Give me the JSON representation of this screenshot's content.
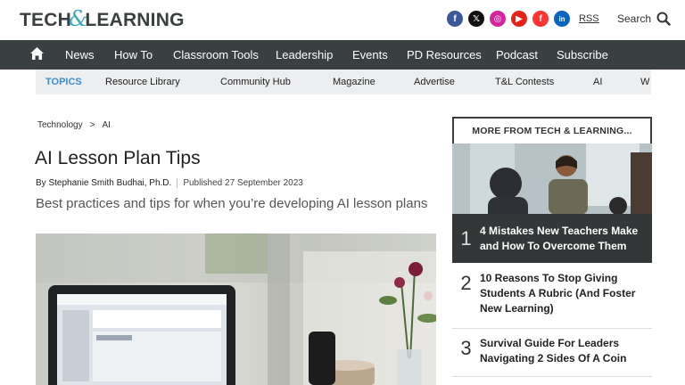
{
  "header": {
    "logo": {
      "part1": "TECH",
      "amp": "&",
      "part2": "LEARNING"
    },
    "social": [
      {
        "name": "facebook",
        "glyph": "f"
      },
      {
        "name": "x",
        "glyph": "𝕏"
      },
      {
        "name": "instagram",
        "glyph": "◎"
      },
      {
        "name": "youtube",
        "glyph": "▶"
      },
      {
        "name": "flipboard",
        "glyph": "f"
      },
      {
        "name": "linkedin",
        "glyph": "in"
      }
    ],
    "rss": "RSS",
    "search_label": "Search"
  },
  "mainnav": {
    "items": [
      "News",
      "How To",
      "Classroom Tools",
      "Leadership",
      "Events",
      "PD Resources",
      "Podcast",
      "Subscribe"
    ]
  },
  "topics": {
    "label": "TOPICS",
    "items": [
      "Resource Library",
      "Community Hub",
      "Magazine",
      "Advertise",
      "T&L Contests",
      "AI",
      "W"
    ]
  },
  "article": {
    "breadcrumb": [
      "Technology",
      ">",
      "AI"
    ],
    "title": "AI Lesson Plan Tips",
    "author": "By Stephanie Smith Budhai, Ph.D.",
    "published": "Published 27 September 2023",
    "subtitle": "Best practices and tips for when you’re developing AI lesson plans"
  },
  "sidebar": {
    "heading": "MORE FROM TECH & LEARNING...",
    "items": [
      {
        "num": "1",
        "title": "4 Mistakes New Teachers Make and How To Overcome Them"
      },
      {
        "num": "2",
        "title": "10 Reasons To Stop Giving Students A Rubric (And Foster New Learning)"
      },
      {
        "num": "3",
        "title": "Survival Guide For Leaders Navigating 2 Sides Of A Coin"
      }
    ]
  },
  "colors": {
    "nav_bg": "#3a3f41",
    "topics_bg": "#eceef0",
    "topics_label": "#3a8fd0",
    "logo_amp": "#3aa9b9"
  }
}
